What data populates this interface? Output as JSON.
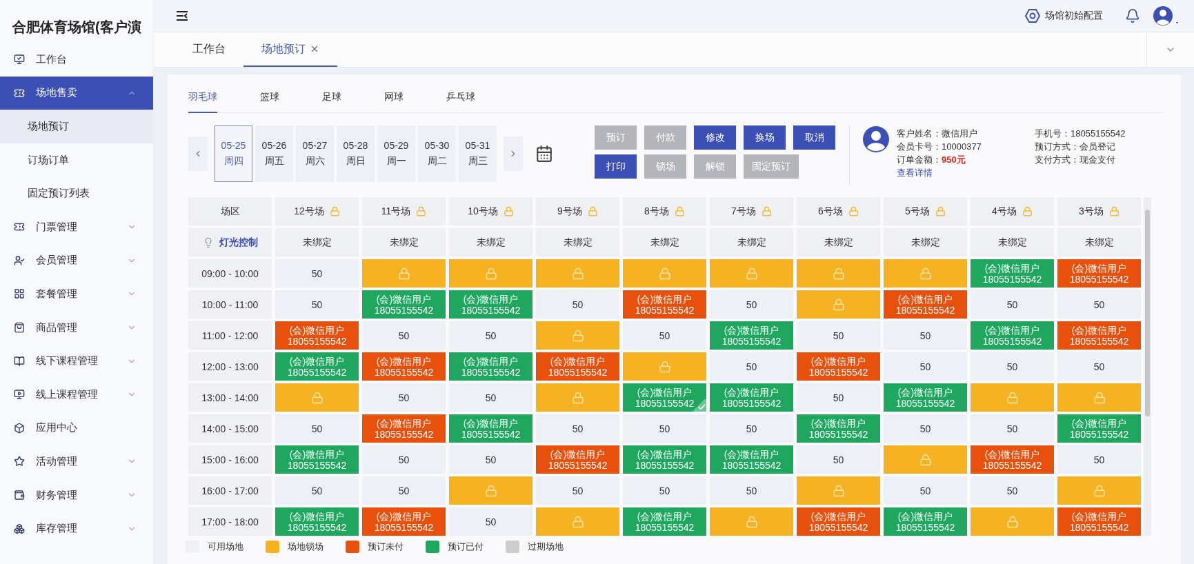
{
  "sidebar": {
    "title": "合肥体育场馆(客户演",
    "items": [
      {
        "label": "工作台",
        "kind": "link",
        "selected": false
      },
      {
        "label": "场地售卖",
        "kind": "group",
        "selected": true,
        "expanded": true,
        "children": [
          {
            "label": "场地预订",
            "selected": true
          },
          {
            "label": "订场订单",
            "selected": false
          },
          {
            "label": "固定预订列表",
            "selected": false
          }
        ]
      },
      {
        "label": "门票管理",
        "kind": "group",
        "selected": false,
        "expanded": false
      },
      {
        "label": "会员管理",
        "kind": "group",
        "selected": false,
        "expanded": false
      },
      {
        "label": "套餐管理",
        "kind": "group",
        "selected": false,
        "expanded": false
      },
      {
        "label": "商品管理",
        "kind": "group",
        "selected": false,
        "expanded": false
      },
      {
        "label": "线下课程管理",
        "kind": "group",
        "selected": false,
        "expanded": false
      },
      {
        "label": "线上课程管理",
        "kind": "group",
        "selected": false,
        "expanded": false
      },
      {
        "label": "应用中心",
        "kind": "link",
        "selected": false
      },
      {
        "label": "活动管理",
        "kind": "group",
        "selected": false,
        "expanded": false
      },
      {
        "label": "财务管理",
        "kind": "group",
        "selected": false,
        "expanded": false
      },
      {
        "label": "库存管理",
        "kind": "group",
        "selected": false,
        "expanded": false
      }
    ]
  },
  "header": {
    "config_label": "场馆初始配置"
  },
  "page_tabs": [
    {
      "label": "工作台",
      "selected": false,
      "closable": false
    },
    {
      "label": "场地预订",
      "selected": true,
      "closable": true
    }
  ],
  "sport_tabs": [
    {
      "label": "羽毛球",
      "selected": true
    },
    {
      "label": "篮球",
      "selected": false
    },
    {
      "label": "足球",
      "selected": false
    },
    {
      "label": "网球",
      "selected": false
    },
    {
      "label": "乒乓球",
      "selected": false
    }
  ],
  "dates": [
    {
      "date": "05-25",
      "weekday": "周四",
      "selected": true
    },
    {
      "date": "05-26",
      "weekday": "周五",
      "selected": false
    },
    {
      "date": "05-27",
      "weekday": "周六",
      "selected": false
    },
    {
      "date": "05-28",
      "weekday": "周日",
      "selected": false
    },
    {
      "date": "05-29",
      "weekday": "周一",
      "selected": false
    },
    {
      "date": "05-30",
      "weekday": "周二",
      "selected": false
    },
    {
      "date": "05-31",
      "weekday": "周三",
      "selected": false
    }
  ],
  "action_rows": [
    [
      {
        "label": "预订",
        "disabled": true
      },
      {
        "label": "付款",
        "disabled": true
      },
      {
        "label": "修改",
        "disabled": false
      },
      {
        "label": "换场",
        "disabled": false
      },
      {
        "label": "取消",
        "disabled": false
      }
    ],
    [
      {
        "label": "打印",
        "disabled": false
      },
      {
        "label": "锁场",
        "disabled": true
      },
      {
        "label": "解锁",
        "disabled": true
      },
      {
        "label": "固定预订",
        "disabled": true
      }
    ]
  ],
  "customer": {
    "columns": [
      [
        {
          "label": "客户姓名：",
          "value": "微信用户",
          "highlight": false
        },
        {
          "label": "会员卡号：",
          "value": "10000377",
          "highlight": false
        },
        {
          "label": "订单金额：",
          "value": "950元",
          "highlight": true
        }
      ],
      [
        {
          "label": "手机号：",
          "value": "18055155542",
          "highlight": false
        },
        {
          "label": "预订方式：",
          "value": "会员登记",
          "highlight": false
        },
        {
          "label": "支付方式：",
          "value": "现金支付",
          "highlight": false
        }
      ]
    ],
    "link": "查看详情"
  },
  "grid": {
    "corner": "场区",
    "courts": [
      "12号场",
      "11号场",
      "10号场",
      "9号场",
      "8号场",
      "7号场",
      "6号场",
      "5号场",
      "4号场",
      "3号场"
    ],
    "light_control": {
      "label": "灯光控制",
      "values": [
        "未绑定",
        "未绑定",
        "未绑定",
        "未绑定",
        "未绑定",
        "未绑定",
        "未绑定",
        "未绑定",
        "未绑定",
        "未绑定"
      ]
    },
    "rows": [
      {
        "time": "09:00 - 10:00",
        "cells": [
          {
            "kind": "free",
            "price": "50",
            "selected": false
          },
          {
            "kind": "locked",
            "selected": false
          },
          {
            "kind": "locked",
            "selected": false
          },
          {
            "kind": "locked",
            "selected": false
          },
          {
            "kind": "locked",
            "selected": false
          },
          {
            "kind": "locked",
            "selected": false
          },
          {
            "kind": "locked",
            "selected": false
          },
          {
            "kind": "locked",
            "selected": false
          },
          {
            "kind": "paid",
            "name": "(会)微信用户",
            "phone": "18055155542",
            "selected": false
          },
          {
            "kind": "unpaid",
            "name": "(会)微信用户",
            "phone": "18055155542",
            "selected": false
          }
        ]
      },
      {
        "time": "10:00 - 11:00",
        "cells": [
          {
            "kind": "free",
            "price": "50",
            "selected": false
          },
          {
            "kind": "paid",
            "name": "(会)微信用户",
            "phone": "18055155542",
            "selected": false
          },
          {
            "kind": "paid",
            "name": "(会)微信用户",
            "phone": "18055155542",
            "selected": false
          },
          {
            "kind": "free",
            "price": "50",
            "selected": false
          },
          {
            "kind": "unpaid",
            "name": "(会)微信用户",
            "phone": "18055155542",
            "selected": false
          },
          {
            "kind": "free",
            "price": "50",
            "selected": false
          },
          {
            "kind": "locked",
            "selected": false
          },
          {
            "kind": "unpaid",
            "name": "(会)微信用户",
            "phone": "18055155542",
            "selected": false
          },
          {
            "kind": "free",
            "price": "50",
            "selected": false
          },
          {
            "kind": "free",
            "price": "50",
            "selected": false
          }
        ]
      },
      {
        "time": "11:00 - 12:00",
        "cells": [
          {
            "kind": "unpaid",
            "name": "(会)微信用户",
            "phone": "18055155542",
            "selected": false
          },
          {
            "kind": "free",
            "price": "50",
            "selected": false
          },
          {
            "kind": "free",
            "price": "50",
            "selected": false
          },
          {
            "kind": "locked",
            "selected": false
          },
          {
            "kind": "free",
            "price": "50",
            "selected": false
          },
          {
            "kind": "paid",
            "name": "(会)微信用户",
            "phone": "18055155542",
            "selected": false
          },
          {
            "kind": "free",
            "price": "50",
            "selected": false
          },
          {
            "kind": "free",
            "price": "50",
            "selected": false
          },
          {
            "kind": "paid",
            "name": "(会)微信用户",
            "phone": "18055155542",
            "selected": false
          },
          {
            "kind": "unpaid",
            "name": "(会)微信用户",
            "phone": "18055155542",
            "selected": false
          }
        ]
      },
      {
        "time": "12:00 - 13:00",
        "cells": [
          {
            "kind": "paid",
            "name": "(会)微信用户",
            "phone": "18055155542",
            "selected": false
          },
          {
            "kind": "unpaid",
            "name": "(会)微信用户",
            "phone": "18055155542",
            "selected": false
          },
          {
            "kind": "paid",
            "name": "(会)微信用户",
            "phone": "18055155542",
            "selected": false
          },
          {
            "kind": "unpaid",
            "name": "(会)微信用户",
            "phone": "18055155542",
            "selected": false
          },
          {
            "kind": "locked",
            "selected": false
          },
          {
            "kind": "free",
            "price": "50",
            "selected": false
          },
          {
            "kind": "unpaid",
            "name": "(会)微信用户",
            "phone": "18055155542",
            "selected": false
          },
          {
            "kind": "free",
            "price": "50",
            "selected": false
          },
          {
            "kind": "free",
            "price": "50",
            "selected": false
          },
          {
            "kind": "free",
            "price": "50",
            "selected": false
          }
        ]
      },
      {
        "time": "13:00 - 14:00",
        "cells": [
          {
            "kind": "locked",
            "selected": false
          },
          {
            "kind": "free",
            "price": "50",
            "selected": false
          },
          {
            "kind": "free",
            "price": "50",
            "selected": false
          },
          {
            "kind": "locked",
            "selected": false
          },
          {
            "kind": "paid",
            "name": "(会)微信用户",
            "phone": "18055155542",
            "selected": true
          },
          {
            "kind": "paid",
            "name": "(会)微信用户",
            "phone": "18055155542",
            "selected": false
          },
          {
            "kind": "free",
            "price": "50",
            "selected": false
          },
          {
            "kind": "paid",
            "name": "(会)微信用户",
            "phone": "18055155542",
            "selected": false
          },
          {
            "kind": "locked",
            "selected": false
          },
          {
            "kind": "locked",
            "selected": false
          }
        ]
      },
      {
        "time": "14:00 - 15:00",
        "cells": [
          {
            "kind": "free",
            "price": "50",
            "selected": false
          },
          {
            "kind": "unpaid",
            "name": "(会)微信用户",
            "phone": "18055155542",
            "selected": false
          },
          {
            "kind": "paid",
            "name": "(会)微信用户",
            "phone": "18055155542",
            "selected": false
          },
          {
            "kind": "free",
            "price": "50",
            "selected": false
          },
          {
            "kind": "free",
            "price": "50",
            "selected": false
          },
          {
            "kind": "free",
            "price": "50",
            "selected": false
          },
          {
            "kind": "paid",
            "name": "(会)微信用户",
            "phone": "18055155542",
            "selected": false
          },
          {
            "kind": "free",
            "price": "50",
            "selected": false
          },
          {
            "kind": "free",
            "price": "50",
            "selected": false
          },
          {
            "kind": "paid",
            "name": "(会)微信用户",
            "phone": "18055155542",
            "selected": false
          }
        ]
      },
      {
        "time": "15:00 - 16:00",
        "cells": [
          {
            "kind": "paid",
            "name": "(会)微信用户",
            "phone": "18055155542",
            "selected": false
          },
          {
            "kind": "free",
            "price": "50",
            "selected": false
          },
          {
            "kind": "free",
            "price": "50",
            "selected": false
          },
          {
            "kind": "unpaid",
            "name": "(会)微信用户",
            "phone": "18055155542",
            "selected": false
          },
          {
            "kind": "paid",
            "name": "(会)微信用户",
            "phone": "18055155542",
            "selected": false
          },
          {
            "kind": "paid",
            "name": "(会)微信用户",
            "phone": "18055155542",
            "selected": false
          },
          {
            "kind": "free",
            "price": "50",
            "selected": false
          },
          {
            "kind": "locked",
            "selected": false
          },
          {
            "kind": "unpaid",
            "name": "(会)微信用户",
            "phone": "18055155542",
            "selected": false
          },
          {
            "kind": "free",
            "price": "50",
            "selected": false
          }
        ]
      },
      {
        "time": "16:00 - 17:00",
        "cells": [
          {
            "kind": "free",
            "price": "50",
            "selected": false
          },
          {
            "kind": "free",
            "price": "50",
            "selected": false
          },
          {
            "kind": "locked",
            "selected": false
          },
          {
            "kind": "free",
            "price": "50",
            "selected": false
          },
          {
            "kind": "free",
            "price": "50",
            "selected": false
          },
          {
            "kind": "free",
            "price": "50",
            "selected": false
          },
          {
            "kind": "locked",
            "selected": false
          },
          {
            "kind": "free",
            "price": "50",
            "selected": false
          },
          {
            "kind": "free",
            "price": "50",
            "selected": false
          },
          {
            "kind": "locked",
            "selected": false
          }
        ]
      },
      {
        "time": "17:00 - 18:00",
        "cells": [
          {
            "kind": "paid",
            "name": "(会)微信用户",
            "phone": "18055155542",
            "selected": false
          },
          {
            "kind": "unpaid",
            "name": "(会)微信用户",
            "phone": "18055155542",
            "selected": false
          },
          {
            "kind": "free",
            "price": "50",
            "selected": false
          },
          {
            "kind": "locked",
            "selected": false
          },
          {
            "kind": "paid",
            "name": "(会)微信用户",
            "phone": "18055155542",
            "selected": false
          },
          {
            "kind": "locked",
            "selected": false
          },
          {
            "kind": "unpaid",
            "name": "(会)微信用户",
            "phone": "18055155542",
            "selected": false
          },
          {
            "kind": "paid",
            "name": "(会)微信用户",
            "phone": "18055155542",
            "selected": false
          },
          {
            "kind": "locked",
            "selected": false
          },
          {
            "kind": "unpaid",
            "name": "(会)微信用户",
            "phone": "18055155542",
            "selected": false
          }
        ]
      }
    ]
  },
  "legend": [
    {
      "label": "可用场地",
      "color": "#eef0f8"
    },
    {
      "label": "场地锁场",
      "color": "#f5b323"
    },
    {
      "label": "预订未付",
      "color": "#e8500e"
    },
    {
      "label": "预订已付",
      "color": "#1fa760"
    },
    {
      "label": "过期场地",
      "color": "#cccccc"
    }
  ]
}
